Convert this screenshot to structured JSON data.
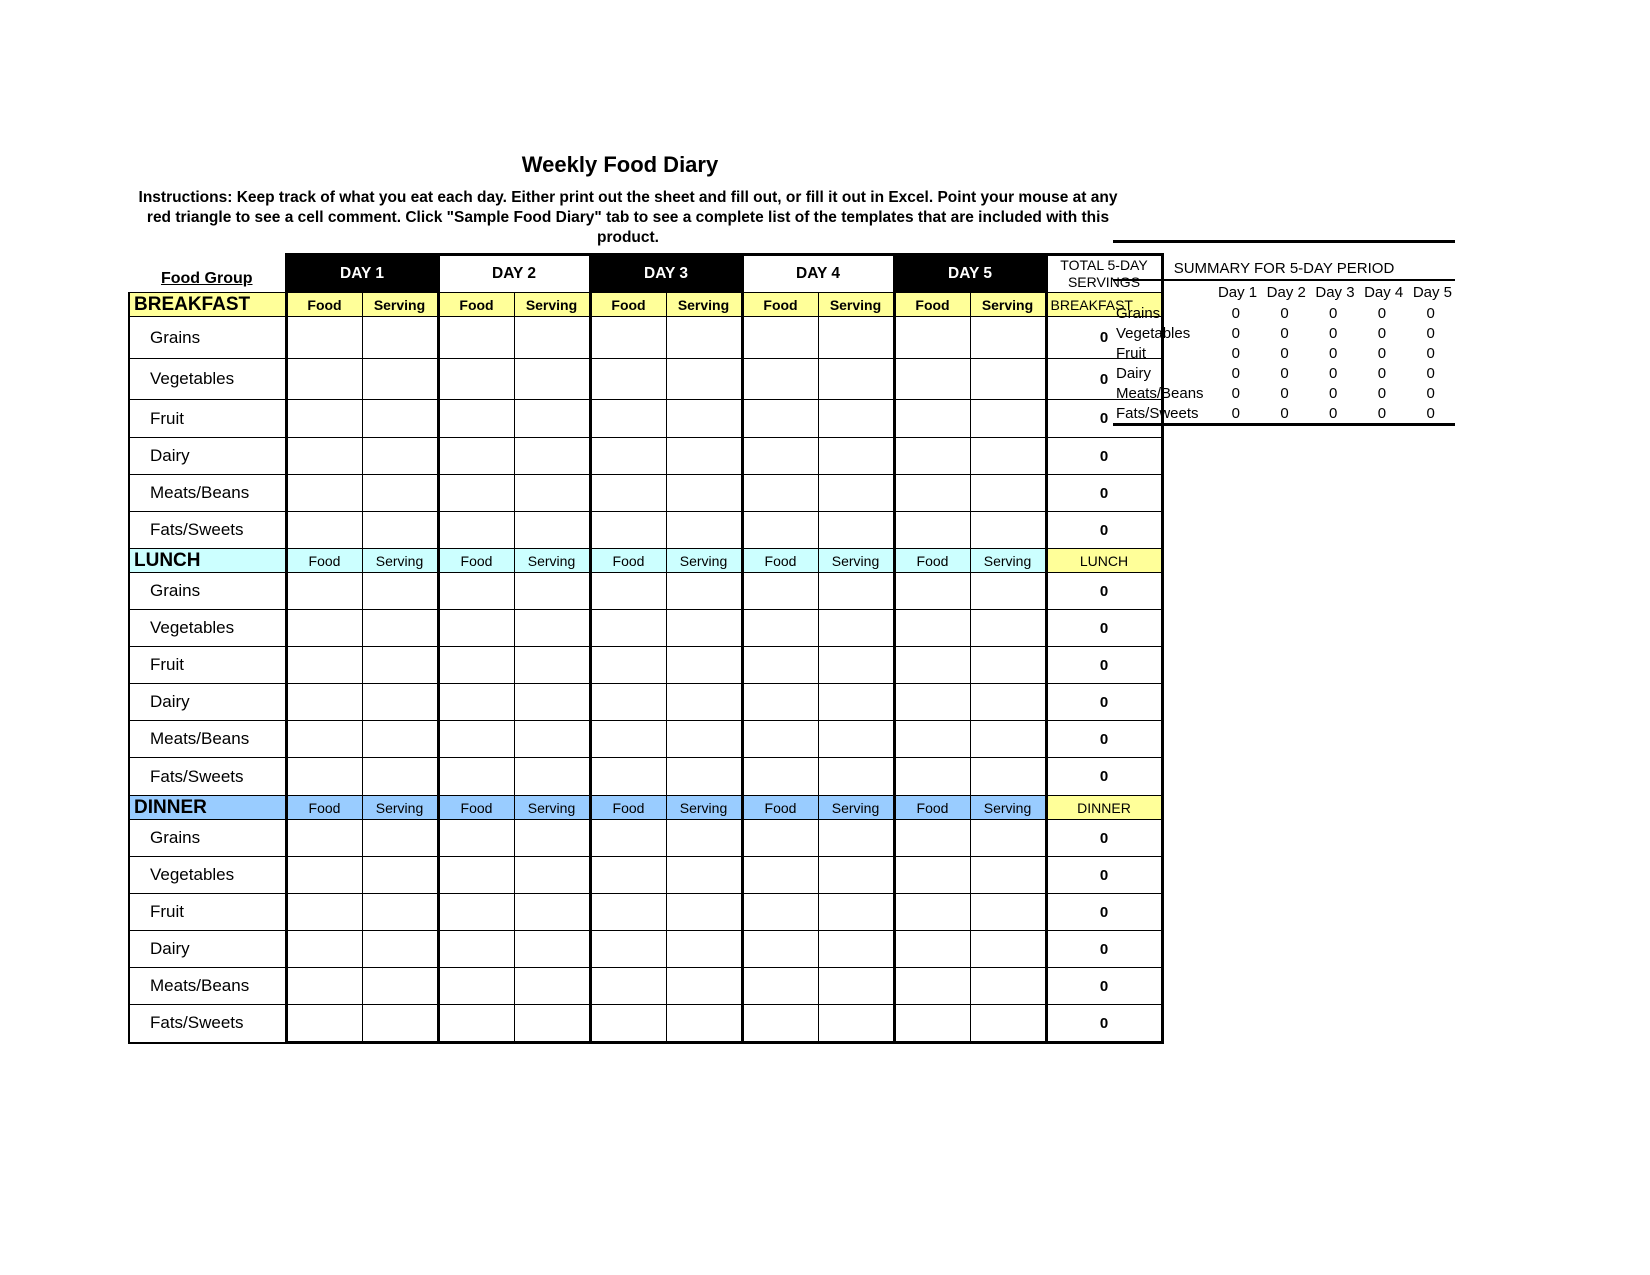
{
  "title": "Weekly Food Diary",
  "instructions": "Instructions:  Keep track of what you eat each day. Either print out the sheet and fill out, or fill it out in Excel. Point your mouse at any red triangle to see a cell comment.  Click \"Sample Food Diary\" tab to see a complete list of the templates that are included with this product.",
  "header": {
    "food_group_label": "Food Group",
    "days": [
      "DAY 1",
      "DAY 2",
      "DAY 3",
      "DAY 4",
      "DAY 5"
    ],
    "total_label_line1": "TOTAL 5-DAY",
    "total_label_line2": "SERVINGS",
    "food_label": "Food",
    "serving_label": "Serving"
  },
  "colors": {
    "breakfast_bg": "#ffff99",
    "lunch_bg": "#ccffff",
    "dinner_bg": "#99ccff",
    "total_header_bg": "#ffff99",
    "dark_day_bg": "#000000"
  },
  "sections": [
    {
      "name": "BREAKFAST",
      "total_label": "BREAKFAST",
      "rows": [
        {
          "group": "Grains",
          "total": "0"
        },
        {
          "group": "Vegetables",
          "total": "0"
        },
        {
          "group": "Fruit",
          "total": "0"
        },
        {
          "group": "Dairy",
          "total": "0"
        },
        {
          "group": "Meats/Beans",
          "total": "0"
        },
        {
          "group": "Fats/Sweets",
          "total": "0"
        }
      ]
    },
    {
      "name": "LUNCH",
      "total_label": "LUNCH",
      "rows": [
        {
          "group": "Grains",
          "total": "0"
        },
        {
          "group": "Vegetables",
          "total": "0"
        },
        {
          "group": "Fruit",
          "total": "0"
        },
        {
          "group": "Dairy",
          "total": "0"
        },
        {
          "group": "Meats/Beans",
          "total": "0"
        },
        {
          "group": "Fats/Sweets",
          "total": "0"
        }
      ]
    },
    {
      "name": "DINNER",
      "total_label": "DINNER",
      "rows": [
        {
          "group": "Grains",
          "total": "0"
        },
        {
          "group": "Vegetables",
          "total": "0"
        },
        {
          "group": "Fruit",
          "total": "0"
        },
        {
          "group": "Dairy",
          "total": "0"
        },
        {
          "group": "Meats/Beans",
          "total": "0"
        },
        {
          "group": "Fats/Sweets",
          "total": "0"
        }
      ]
    }
  ],
  "summary": {
    "title": "SUMMARY FOR 5-DAY PERIOD",
    "columns": [
      "Day 1",
      "Day 2",
      "Day 3",
      "Day 4",
      "Day 5"
    ],
    "rows": [
      {
        "label": "Grains",
        "values": [
          "0",
          "0",
          "0",
          "0",
          "0"
        ]
      },
      {
        "label": "Vegetables",
        "values": [
          "0",
          "0",
          "0",
          "0",
          "0"
        ]
      },
      {
        "label": "Fruit",
        "values": [
          "0",
          "0",
          "0",
          "0",
          "0"
        ]
      },
      {
        "label": "Dairy",
        "values": [
          "0",
          "0",
          "0",
          "0",
          "0"
        ]
      },
      {
        "label": "Meats/Beans",
        "values": [
          "0",
          "0",
          "0",
          "0",
          "0"
        ]
      },
      {
        "label": "Fats/Sweets",
        "values": [
          "0",
          "0",
          "0",
          "0",
          "0"
        ]
      }
    ]
  }
}
